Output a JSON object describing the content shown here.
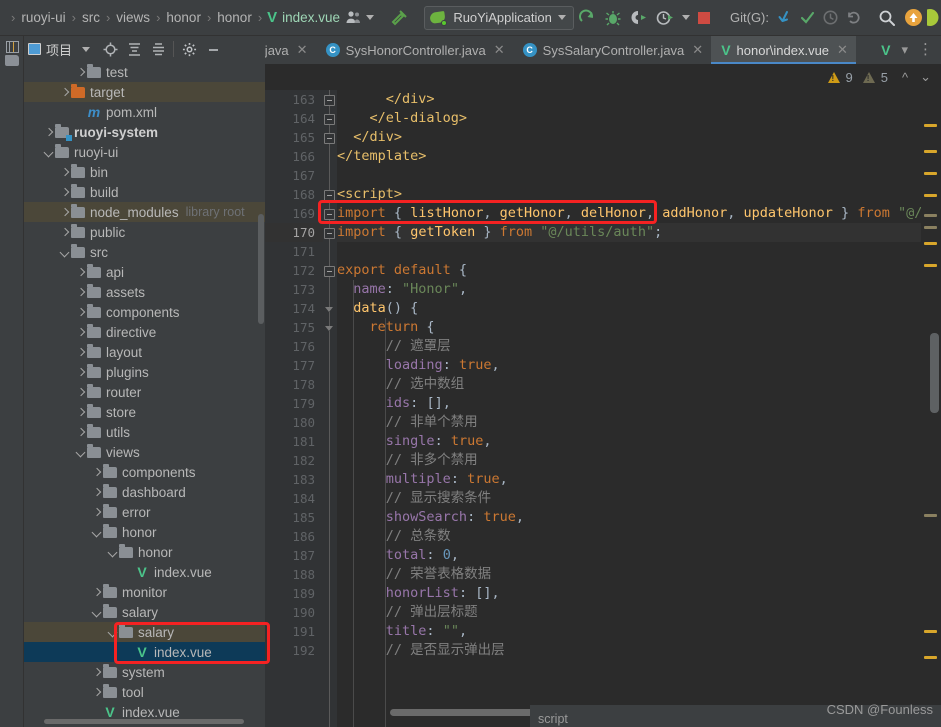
{
  "toolbar": {
    "breadcrumbs": [
      "ruoyi-ui",
      "src",
      "views",
      "honor",
      "honor",
      "index.vue"
    ],
    "breadcrumb_separator": "›",
    "vue_glyph": "V",
    "avatar_icon": "user-group-icon",
    "hammer_icon": "build-hammer-icon",
    "run_config": "RuoYiApplication",
    "run_icon": "run-icon",
    "debug_icon": "debug-bug-icon",
    "coverage_icon": "run-with-coverage-icon",
    "profile_icon": "profiler-icon",
    "stop_icon": "stop-icon",
    "git_label": "Git(G):",
    "git_update_icon": "update-project-icon",
    "git_commit_icon": "commit-checkmark-icon",
    "git_history_icon": "history-clock-icon",
    "git_rollback_icon": "rollback-icon",
    "search_icon": "search-icon",
    "notification_icon": "update-available-icon"
  },
  "project_panel": {
    "tool_tab_label": "项目",
    "title": "项目",
    "dropdown_icon": "chevron-down-icon",
    "locate_icon": "select-opened-file-icon",
    "expand_icon": "expand-all-icon",
    "collapse_icon": "collapse-all-icon",
    "settings_icon": "gear-icon",
    "hide_icon": "minimize-icon",
    "tree": [
      {
        "label": "test",
        "indent": 4,
        "kind": "folder",
        "arrow": "closed"
      },
      {
        "label": "target",
        "indent": 3,
        "kind": "folder-orange",
        "arrow": "closed",
        "state": "highlight"
      },
      {
        "label": "pom.xml",
        "indent": 4,
        "kind": "maven",
        "arrow": "none"
      },
      {
        "label": "ruoyi-system",
        "indent": 2,
        "kind": "module",
        "arrow": "closed",
        "bold": true
      },
      {
        "label": "ruoyi-ui",
        "indent": 2,
        "kind": "folder",
        "arrow": "open"
      },
      {
        "label": "bin",
        "indent": 3,
        "kind": "folder",
        "arrow": "closed"
      },
      {
        "label": "build",
        "indent": 3,
        "kind": "folder",
        "arrow": "closed"
      },
      {
        "label": "node_modules",
        "indent": 3,
        "kind": "folder",
        "arrow": "closed",
        "hint": "library root",
        "state": "highlight"
      },
      {
        "label": "public",
        "indent": 3,
        "kind": "folder",
        "arrow": "closed"
      },
      {
        "label": "src",
        "indent": 3,
        "kind": "folder",
        "arrow": "open"
      },
      {
        "label": "api",
        "indent": 4,
        "kind": "folder",
        "arrow": "closed"
      },
      {
        "label": "assets",
        "indent": 4,
        "kind": "folder",
        "arrow": "closed"
      },
      {
        "label": "components",
        "indent": 4,
        "kind": "folder",
        "arrow": "closed"
      },
      {
        "label": "directive",
        "indent": 4,
        "kind": "folder",
        "arrow": "closed"
      },
      {
        "label": "layout",
        "indent": 4,
        "kind": "folder",
        "arrow": "closed"
      },
      {
        "label": "plugins",
        "indent": 4,
        "kind": "folder",
        "arrow": "closed"
      },
      {
        "label": "router",
        "indent": 4,
        "kind": "folder",
        "arrow": "closed"
      },
      {
        "label": "store",
        "indent": 4,
        "kind": "folder",
        "arrow": "closed"
      },
      {
        "label": "utils",
        "indent": 4,
        "kind": "folder",
        "arrow": "closed"
      },
      {
        "label": "views",
        "indent": 4,
        "kind": "folder",
        "arrow": "open"
      },
      {
        "label": "components",
        "indent": 5,
        "kind": "folder",
        "arrow": "closed"
      },
      {
        "label": "dashboard",
        "indent": 5,
        "kind": "folder",
        "arrow": "closed"
      },
      {
        "label": "error",
        "indent": 5,
        "kind": "folder",
        "arrow": "closed"
      },
      {
        "label": "honor",
        "indent": 5,
        "kind": "folder",
        "arrow": "open"
      },
      {
        "label": "honor",
        "indent": 6,
        "kind": "folder",
        "arrow": "open"
      },
      {
        "label": "index.vue",
        "indent": 7,
        "kind": "vue",
        "arrow": "none"
      },
      {
        "label": "monitor",
        "indent": 5,
        "kind": "folder",
        "arrow": "closed"
      },
      {
        "label": "salary",
        "indent": 5,
        "kind": "folder",
        "arrow": "open"
      },
      {
        "label": "salary",
        "indent": 6,
        "kind": "folder",
        "arrow": "open",
        "state": "highlight"
      },
      {
        "label": "index.vue",
        "indent": 7,
        "kind": "vue",
        "arrow": "none",
        "state": "selected"
      },
      {
        "label": "system",
        "indent": 5,
        "kind": "folder",
        "arrow": "closed"
      },
      {
        "label": "tool",
        "indent": 5,
        "kind": "folder",
        "arrow": "closed"
      },
      {
        "label": "index.vue",
        "indent": 5,
        "kind": "vue",
        "arrow": "none"
      }
    ]
  },
  "editor": {
    "tabs": [
      {
        "label": "ation.java",
        "icon": "java-class-icon",
        "active": false,
        "clipped": true
      },
      {
        "label": "SysHonorController.java",
        "icon": "java-class-icon",
        "active": false
      },
      {
        "label": "SysSalaryController.java",
        "icon": "java-class-icon",
        "active": false
      },
      {
        "label": "honor\\index.vue",
        "icon": "vue-file-icon",
        "active": true
      }
    ],
    "tab_close_icon": "close-icon",
    "tabs_overflow_icon": "chevron-down-icon",
    "tabs_more_icon": "more-options-icon",
    "tabs_vue_icon": "vue-file-icon",
    "inspections": {
      "warning_icon": "warning-triangle-icon",
      "warning_count": "9",
      "weak_warning_icon": "weak-warning-triangle-icon",
      "weak_warning_count": "5",
      "prev_icon": "chevron-up-icon",
      "next_icon": "chevron-down-icon"
    },
    "first_line_number": 163,
    "current_line": 170,
    "lines": [
      {
        "n": 163,
        "segs": [
          {
            "t": "      </div>",
            "c": "tok-tag"
          }
        ]
      },
      {
        "n": 164,
        "segs": [
          {
            "t": "    </el-dialog>",
            "c": "tok-tag"
          }
        ]
      },
      {
        "n": 165,
        "segs": [
          {
            "t": "  </div>",
            "c": "tok-tag"
          }
        ]
      },
      {
        "n": 166,
        "segs": [
          {
            "t": "</template>",
            "c": "tok-tag"
          }
        ]
      },
      {
        "n": 167,
        "segs": []
      },
      {
        "n": 168,
        "segs": [
          {
            "t": "<script>",
            "c": "tok-tag"
          }
        ]
      },
      {
        "n": 169,
        "segs": [
          {
            "t": "import",
            "c": "tok-kw"
          },
          {
            "t": " ",
            "c": "tok-id"
          },
          {
            "t": "{",
            "c": "tok-brace"
          },
          {
            "t": " listHonor",
            "c": "tok-fn"
          },
          {
            "t": ",",
            "c": "tok-punct"
          },
          {
            "t": " getHonor",
            "c": "tok-fn"
          },
          {
            "t": ",",
            "c": "tok-punct"
          },
          {
            "t": " delHonor",
            "c": "tok-fn"
          },
          {
            "t": ",",
            "c": "tok-punct"
          },
          {
            "t": " addHonor",
            "c": "tok-fn"
          },
          {
            "t": ",",
            "c": "tok-punct"
          },
          {
            "t": " updateHonor",
            "c": "tok-fn"
          },
          {
            "t": " }",
            "c": "tok-brace"
          },
          {
            "t": " ",
            "c": "tok-id"
          },
          {
            "t": "from",
            "c": "tok-kw"
          },
          {
            "t": " ",
            "c": "tok-id"
          },
          {
            "t": "\"@/api/h",
            "c": "tok-str"
          }
        ]
      },
      {
        "n": 170,
        "segs": [
          {
            "t": "import",
            "c": "tok-kw"
          },
          {
            "t": " ",
            "c": "tok-id"
          },
          {
            "t": "{",
            "c": "tok-brace"
          },
          {
            "t": " getToken",
            "c": "tok-fn"
          },
          {
            "t": " }",
            "c": "tok-brace"
          },
          {
            "t": " ",
            "c": "tok-id"
          },
          {
            "t": "from",
            "c": "tok-kw"
          },
          {
            "t": " ",
            "c": "tok-id"
          },
          {
            "t": "\"@/utils/auth\"",
            "c": "tok-str"
          },
          {
            "t": ";",
            "c": "tok-punct"
          }
        ]
      },
      {
        "n": 171,
        "segs": []
      },
      {
        "n": 172,
        "segs": [
          {
            "t": "export default",
            "c": "tok-kw"
          },
          {
            "t": " {",
            "c": "tok-brace"
          }
        ]
      },
      {
        "n": 173,
        "segs": [
          {
            "t": "  ",
            "c": "tok-id"
          },
          {
            "t": "name",
            "c": "tok-prop"
          },
          {
            "t": ": ",
            "c": "tok-punct"
          },
          {
            "t": "\"Honor\"",
            "c": "tok-str"
          },
          {
            "t": ",",
            "c": "tok-punct"
          }
        ]
      },
      {
        "n": 174,
        "segs": [
          {
            "t": "  ",
            "c": "tok-id"
          },
          {
            "t": "data",
            "c": "tok-fn"
          },
          {
            "t": "() {",
            "c": "tok-brace"
          }
        ]
      },
      {
        "n": 175,
        "segs": [
          {
            "t": "    ",
            "c": "tok-id"
          },
          {
            "t": "return",
            "c": "tok-kw"
          },
          {
            "t": " {",
            "c": "tok-brace"
          }
        ]
      },
      {
        "n": 176,
        "segs": [
          {
            "t": "      ",
            "c": "tok-id"
          },
          {
            "t": "// 遮罩层",
            "c": "tok-cmt"
          }
        ]
      },
      {
        "n": 177,
        "segs": [
          {
            "t": "      ",
            "c": "tok-id"
          },
          {
            "t": "loading",
            "c": "tok-prop"
          },
          {
            "t": ": ",
            "c": "tok-punct"
          },
          {
            "t": "true",
            "c": "tok-bool"
          },
          {
            "t": ",",
            "c": "tok-punct"
          }
        ]
      },
      {
        "n": 178,
        "segs": [
          {
            "t": "      ",
            "c": "tok-id"
          },
          {
            "t": "// 选中数组",
            "c": "tok-cmt"
          }
        ]
      },
      {
        "n": 179,
        "segs": [
          {
            "t": "      ",
            "c": "tok-id"
          },
          {
            "t": "ids",
            "c": "tok-prop"
          },
          {
            "t": ": ",
            "c": "tok-punct"
          },
          {
            "t": "[]",
            "c": "tok-brace"
          },
          {
            "t": ",",
            "c": "tok-punct"
          }
        ]
      },
      {
        "n": 180,
        "segs": [
          {
            "t": "      ",
            "c": "tok-id"
          },
          {
            "t": "// 非单个禁用",
            "c": "tok-cmt"
          }
        ]
      },
      {
        "n": 181,
        "segs": [
          {
            "t": "      ",
            "c": "tok-id"
          },
          {
            "t": "single",
            "c": "tok-prop"
          },
          {
            "t": ": ",
            "c": "tok-punct"
          },
          {
            "t": "true",
            "c": "tok-bool"
          },
          {
            "t": ",",
            "c": "tok-punct"
          }
        ]
      },
      {
        "n": 182,
        "segs": [
          {
            "t": "      ",
            "c": "tok-id"
          },
          {
            "t": "// 非多个禁用",
            "c": "tok-cmt"
          }
        ]
      },
      {
        "n": 183,
        "segs": [
          {
            "t": "      ",
            "c": "tok-id"
          },
          {
            "t": "multiple",
            "c": "tok-prop"
          },
          {
            "t": ": ",
            "c": "tok-punct"
          },
          {
            "t": "true",
            "c": "tok-bool"
          },
          {
            "t": ",",
            "c": "tok-punct"
          }
        ]
      },
      {
        "n": 184,
        "segs": [
          {
            "t": "      ",
            "c": "tok-id"
          },
          {
            "t": "// 显示搜索条件",
            "c": "tok-cmt"
          }
        ]
      },
      {
        "n": 185,
        "segs": [
          {
            "t": "      ",
            "c": "tok-id"
          },
          {
            "t": "showSearch",
            "c": "tok-prop"
          },
          {
            "t": ": ",
            "c": "tok-punct"
          },
          {
            "t": "true",
            "c": "tok-bool"
          },
          {
            "t": ",",
            "c": "tok-punct"
          }
        ]
      },
      {
        "n": 186,
        "segs": [
          {
            "t": "      ",
            "c": "tok-id"
          },
          {
            "t": "// 总条数",
            "c": "tok-cmt"
          }
        ]
      },
      {
        "n": 187,
        "segs": [
          {
            "t": "      ",
            "c": "tok-id"
          },
          {
            "t": "total",
            "c": "tok-prop"
          },
          {
            "t": ": ",
            "c": "tok-punct"
          },
          {
            "t": "0",
            "c": "tok-num"
          },
          {
            "t": ",",
            "c": "tok-punct"
          }
        ]
      },
      {
        "n": 188,
        "segs": [
          {
            "t": "      ",
            "c": "tok-id"
          },
          {
            "t": "// 荣誉表格数据",
            "c": "tok-cmt"
          }
        ]
      },
      {
        "n": 189,
        "segs": [
          {
            "t": "      ",
            "c": "tok-id"
          },
          {
            "t": "honorList",
            "c": "tok-prop"
          },
          {
            "t": ": ",
            "c": "tok-punct"
          },
          {
            "t": "[]",
            "c": "tok-brace"
          },
          {
            "t": ",",
            "c": "tok-punct"
          }
        ]
      },
      {
        "n": 190,
        "segs": [
          {
            "t": "      ",
            "c": "tok-id"
          },
          {
            "t": "// 弹出层标题",
            "c": "tok-cmt"
          }
        ]
      },
      {
        "n": 191,
        "segs": [
          {
            "t": "      ",
            "c": "tok-id"
          },
          {
            "t": "title",
            "c": "tok-prop"
          },
          {
            "t": ": ",
            "c": "tok-punct"
          },
          {
            "t": "\"\"",
            "c": "tok-str"
          },
          {
            "t": ",",
            "c": "tok-punct"
          }
        ]
      },
      {
        "n": 192,
        "segs": [
          {
            "t": "      ",
            "c": "tok-id"
          },
          {
            "t": "// 是否显示弹出层",
            "c": "tok-cmt"
          }
        ]
      }
    ],
    "breadcrumb_bottom": "script"
  },
  "watermark": "CSDN @Founless",
  "colors": {
    "accent": "#4a88c7",
    "selection": "#0d3a58",
    "annotation": "#f52222",
    "vue_green": "#4bc48a",
    "editor_bg": "#2b2b2b",
    "panel_bg": "#3c3f41"
  }
}
